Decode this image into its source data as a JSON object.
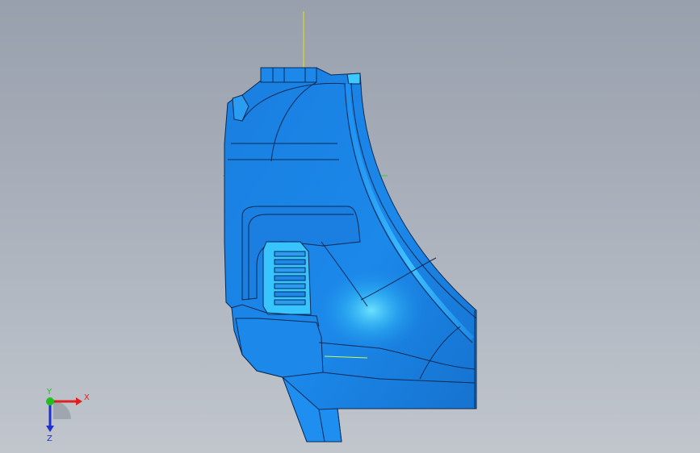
{
  "viewport": {
    "background_top": "#98a0ad",
    "background_bottom": "#c1c6cd",
    "model_color": "#1a85e6",
    "model_highlight": "#33ccff",
    "edge_color": "#0a2a55"
  },
  "origin_marker": {
    "vertical_axis_color": "#e6e600",
    "horizontal_axis_color": "#33cc33"
  },
  "triad": {
    "x_label": "X",
    "y_label": "Y",
    "z_label": "Z",
    "x_color": "#e02020",
    "y_color": "#20c020",
    "z_color": "#2030d0"
  }
}
